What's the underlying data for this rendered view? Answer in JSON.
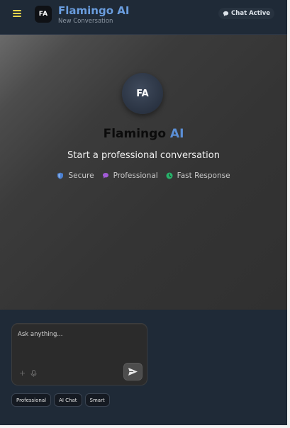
{
  "header": {
    "menu_icon": "hamburger-menu-icon",
    "logo_initials": "FA",
    "title": "Flamingo AI",
    "subtitle": "New Conversation",
    "status_label": "Chat Active",
    "status_icon": "chat-bubble-icon"
  },
  "hero": {
    "avatar_initials": "FA",
    "brand_part1": "Flamingo",
    "brand_part2": "AI",
    "tagline": "Start a professional conversation",
    "features": [
      {
        "label": "Secure",
        "icon": "shield-icon",
        "color": "#4a7fd0"
      },
      {
        "label": "Professional",
        "icon": "chat-bubble-icon",
        "color": "#a15bd6"
      },
      {
        "label": "Fast Response",
        "icon": "clock-icon",
        "color": "#27b36b"
      }
    ]
  },
  "composer": {
    "placeholder": "Ask anything...",
    "value": "",
    "attach_icon": "plus-icon",
    "mic_icon": "microphone-icon",
    "send_icon": "send-icon"
  },
  "chips": [
    "Professional",
    "AI Chat",
    "Smart"
  ],
  "colors": {
    "header_bg": "#1f2a37",
    "accent_blue": "#5b8fd6",
    "menu_yellow": "#e9d74c"
  }
}
